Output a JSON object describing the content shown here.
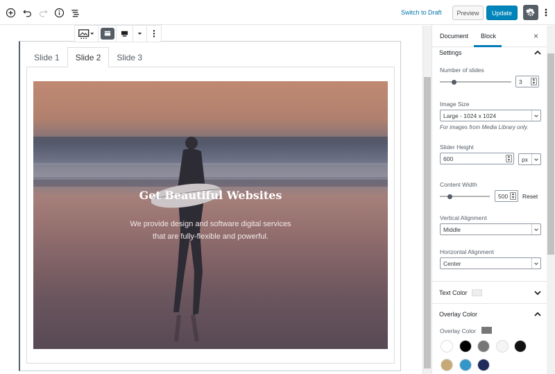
{
  "topbar": {
    "add_icon": "plus-circle-icon",
    "undo_icon": "undo-icon",
    "redo_icon": "redo-icon",
    "info_icon": "info-icon",
    "outline_icon": "list-icon",
    "switch_draft": "Switch to Draft",
    "preview": "Preview",
    "update": "Update",
    "settings_icon": "gear-icon",
    "more_icon": "vertical-dots-icon"
  },
  "block_toolbar": {
    "items": [
      "slider-block-icon",
      "align-full-icon",
      "align-wide-icon",
      "caret-down-icon",
      "more-options-icon"
    ]
  },
  "slider": {
    "tabs": [
      "Slide 1",
      "Slide 2",
      "Slide 3"
    ],
    "active_tab": 1,
    "slide_title": "Get Beautiful Websites",
    "slide_text_line1": "We provide design and software digital services",
    "slide_text_line2": "that are fully-flexible and powerful."
  },
  "sidebar": {
    "tab_document": "Document",
    "tab_block": "Block",
    "close": "×",
    "settings": {
      "title": "Settings",
      "number_of_slides_label": "Number of slides",
      "number_of_slides_value": "3",
      "number_of_slides_fraction": 0.2,
      "image_size_label": "Image Size",
      "image_size_value": "Large - 1024 x 1024",
      "image_size_help": "For images from Media Library only.",
      "slider_height_label": "Slider Height",
      "slider_height_value": "600",
      "slider_height_unit": "px",
      "content_width_label": "Content Width",
      "content_width_value": "500",
      "content_width_fraction": 0.2,
      "reset": "Reset",
      "vertical_alignment_label": "Vertical Alignment",
      "vertical_alignment_value": "Middle",
      "horizontal_alignment_label": "Horizontal Alignment",
      "horizontal_alignment_value": "Center"
    },
    "text_color": {
      "title": "Text Color",
      "value": "#eeeeee"
    },
    "overlay_color": {
      "title": "Overlay Color",
      "label": "Overlay Color",
      "value": "#777777",
      "palette": [
        "#ffffff",
        "#000000",
        "#777777",
        "#f5f5f5",
        "#111111",
        "#c5aa78",
        "#3497c9",
        "#1e2b5c"
      ]
    }
  },
  "colors": {
    "accent": "#0085ba",
    "link": "#0073aa"
  }
}
